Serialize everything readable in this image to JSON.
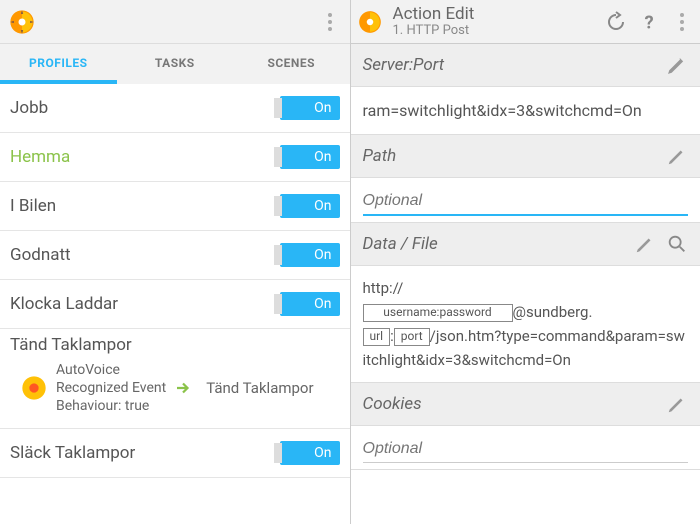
{
  "left": {
    "tabs": {
      "profiles": "PROFILES",
      "tasks": "TASKS",
      "scenes": "SCENES"
    },
    "items": [
      {
        "name": "Jobb",
        "state": "On",
        "active": false
      },
      {
        "name": "Hemma",
        "state": "On",
        "active": true
      },
      {
        "name": "I Bilen",
        "state": "On",
        "active": false
      },
      {
        "name": "Godnatt",
        "state": "On",
        "active": false
      },
      {
        "name": "Klocka Laddar",
        "state": "On",
        "active": false
      },
      {
        "name": "Tänd Taklampor",
        "state": "",
        "active": false,
        "expanded": true,
        "detail_line1": "AutoVoice",
        "detail_line2": "Recognized Event",
        "detail_line3": "Behaviour: true",
        "task": "Tänd Taklampor"
      },
      {
        "name": "Släck Taklampor",
        "state": "On",
        "active": false
      }
    ]
  },
  "right": {
    "title": "Action Edit",
    "subtitle": "1. HTTP Post",
    "sections": {
      "server": {
        "label": "Server:Port",
        "value": "ram=switchlight&idx=3&switchcmd=On"
      },
      "path": {
        "label": "Path",
        "placeholder": "Optional"
      },
      "data": {
        "label": "Data / File",
        "pre": "http://",
        "box_user": "username:password",
        "at": "@sundberg.",
        "box_url": "url",
        "colon": ":",
        "box_port": "port",
        "rest": "/json.htm?type=command&param=switchlight&idx=3&switchcmd=On"
      },
      "cookies": {
        "label": "Cookies",
        "placeholder": "Optional"
      }
    }
  }
}
